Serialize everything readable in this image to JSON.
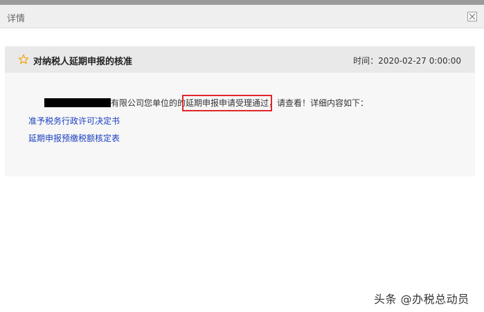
{
  "window": {
    "title": "详情"
  },
  "panel": {
    "title": "对纳税人延期申报的核准",
    "time": "时间：2020-02-27 0:00:00"
  },
  "message": {
    "prefix": "有限公司您单位的的",
    "highlight": "延期申报申请受理通过",
    "suffix": "，请查看！详细内容如下："
  },
  "links": [
    {
      "label": "准予税务行政许可决定书"
    },
    {
      "label": "延期申报预缴税额核定表"
    }
  ],
  "watermark": "头条 @办税总动员",
  "colors": {
    "highlight_box": "#e0262a",
    "link": "#1a3fbf",
    "star": "#f0a818"
  }
}
